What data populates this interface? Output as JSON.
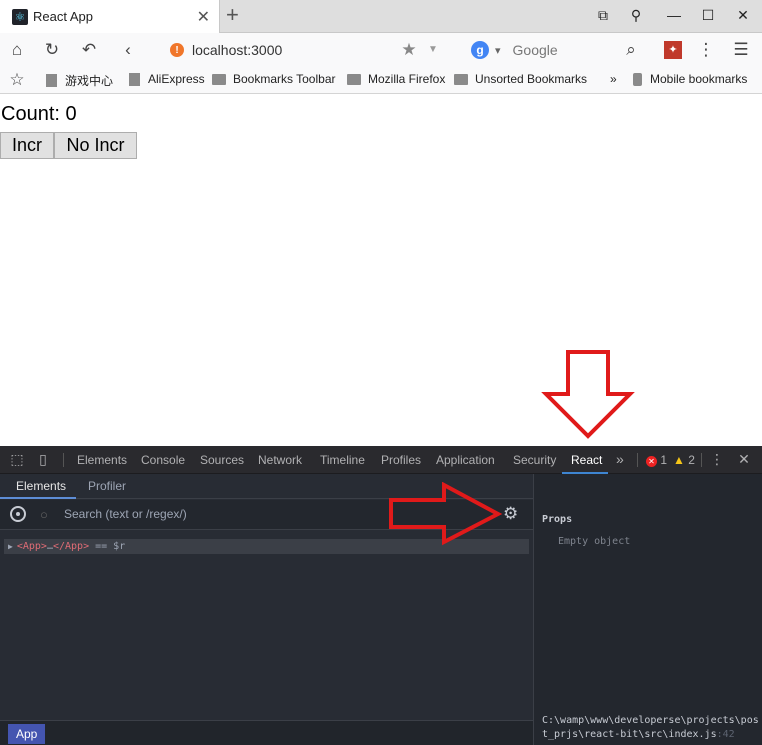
{
  "window": {
    "tab_title": "React App",
    "tab_close": "✕",
    "new_tab": "+",
    "btn_restore": "⧉",
    "btn_pin": "⚲",
    "btn_min": "—",
    "btn_max": "☐",
    "btn_close": "✕"
  },
  "nav": {
    "url": "localhost:3000",
    "search_placeholder": "Google",
    "search_engine_letter": "g"
  },
  "bookmarks": [
    {
      "label": "游戏中心",
      "icon": "page-icon"
    },
    {
      "label": "AliExpress",
      "icon": "page-icon"
    },
    {
      "label": "Bookmarks Toolbar",
      "icon": "folder-icon"
    },
    {
      "label": "Mozilla Firefox",
      "icon": "folder-icon"
    },
    {
      "label": "Unsorted Bookmarks",
      "icon": "folder-icon"
    },
    {
      "label": "Mobile bookmarks",
      "icon": "mobile-icon"
    }
  ],
  "bookmarks_overflow": "»",
  "page": {
    "count_text": "Count: 0",
    "incr_label": "Incr",
    "no_incr_label": "No Incr"
  },
  "devtools": {
    "tabs": [
      "Elements",
      "Console",
      "Sources",
      "Network",
      "Timeline",
      "Profiles",
      "Application",
      "Security",
      "React"
    ],
    "active_tab": "React",
    "more_tabs": "»",
    "error_count": "1",
    "warning_count": "2",
    "menu_icon": "⋮",
    "close_icon": "✕",
    "react": {
      "subtabs": [
        "Elements",
        "Profiler"
      ],
      "search_placeholder": "Search (text or /regex/)",
      "tree_row": {
        "caret": "▶",
        "open_tag": "<App>",
        "ellipsis": "…",
        "close_tag": "</App>",
        "suffix": " == $r"
      },
      "breadcrumb": "App",
      "props_title": "Props",
      "props_empty": "Empty object",
      "source_path": "C:\\wamp\\www\\developerse\\projects\\post_prjs\\react-bit\\src\\index.js",
      "source_line": ":42"
    }
  },
  "colors": {
    "annotation_red": "#e01a1a",
    "react_active_underline": "#3e85d1",
    "breadcrumb_bg": "#4455b0"
  }
}
